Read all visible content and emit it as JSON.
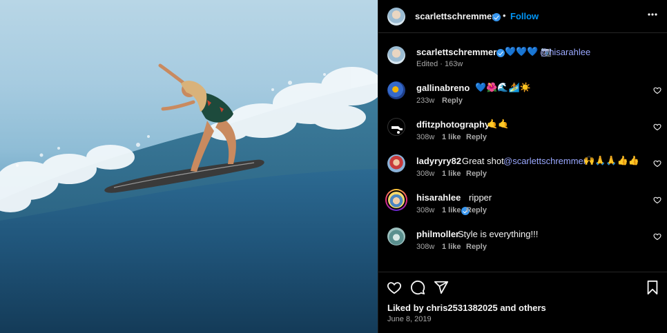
{
  "post": {
    "author": "scarlettschremmer",
    "follow_label": "Follow",
    "more_icon": "more-options-icon"
  },
  "caption": {
    "username": "scarlettschremmer",
    "text": "💙💙💙 📷",
    "mention": "@hisarahlee",
    "meta": "Edited · 163w"
  },
  "comments": [
    {
      "username": "gallinabreno",
      "text": "💙🌺🌊🏄☀️",
      "age": "233w",
      "likes": "",
      "reply": "Reply",
      "verified": false
    },
    {
      "username": "dfitzphotography",
      "text": "🤙🤙",
      "age": "308w",
      "likes": "1 like",
      "reply": "Reply",
      "verified": false
    },
    {
      "username": "ladyryry82",
      "text": "Great shot",
      "mention": "@scarlettschremmer",
      "emoji": "🙌🙏🙏👍👍",
      "age": "308w",
      "likes": "1 like",
      "reply": "Reply",
      "verified": false
    },
    {
      "username": "hisarahlee",
      "text": "ripper",
      "age": "308w",
      "likes": "1 like",
      "reply": "Reply",
      "verified": true
    },
    {
      "username": "philmoller",
      "text": "Style is everything!!!",
      "age": "308w",
      "likes": "1 like",
      "reply": "Reply",
      "verified": false
    }
  ],
  "footer": {
    "liked_by": "Liked by chris2531382025 and others",
    "date": "June 8, 2019"
  },
  "colors": {
    "accent": "#0095f6",
    "verified": "#3897f0",
    "background": "#000000"
  }
}
